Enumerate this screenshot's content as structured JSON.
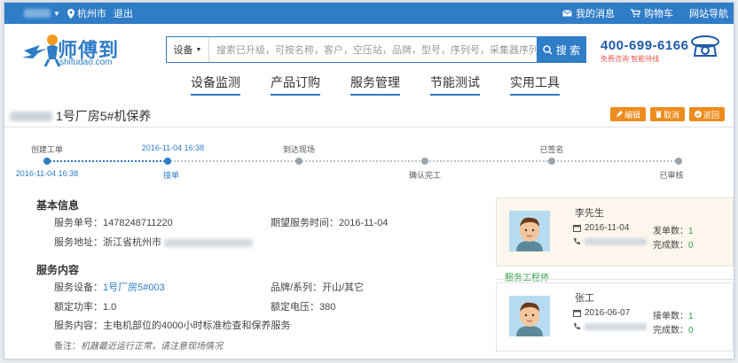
{
  "topbar": {
    "city": "杭州市",
    "logout": "退出",
    "messages": "我的消息",
    "cart": "购物车",
    "sitenav": "网站导航"
  },
  "logo": {
    "name": "师傅到",
    "domain": "shifudao.com"
  },
  "search": {
    "category": "设备",
    "placeholder": "搜索已升级，可按名称，客户，空压站，品牌，型号，序列号，采集器序列号搜索",
    "button": "搜 索"
  },
  "hotline": {
    "number": "400-699-6166",
    "subtitle": "免费咨询  智能待线"
  },
  "nav": [
    "设备监测",
    "产品订购",
    "服务管理",
    "节能测试",
    "实用工具"
  ],
  "page": {
    "title": "1号厂房5#机保养"
  },
  "actions": {
    "edit": "编辑",
    "cancel": "取消",
    "back": "返回"
  },
  "timeline": {
    "steps": [
      {
        "top": "创建工单",
        "bottom": "2016-11-04 16:38",
        "done": true
      },
      {
        "top": "2016-11-04 16:38",
        "bottom": "接单",
        "done": true
      },
      {
        "top": "到达现场",
        "bottom": "",
        "done": false
      },
      {
        "top": "",
        "bottom": "确认完工",
        "done": false
      },
      {
        "top": "已签名",
        "bottom": "",
        "done": false
      },
      {
        "top": "",
        "bottom": "已审核",
        "done": false
      }
    ]
  },
  "basic": {
    "title": "基本信息",
    "order_no_label": "服务单号：",
    "order_no": "1478248711220",
    "expect_label": "期望服务时间：",
    "expect": "2016-11-04",
    "addr_label": "服务地址：",
    "addr": "浙江省杭州市"
  },
  "content": {
    "title": "服务内容",
    "device_label": "服务设备：",
    "device": "1号厂房5#003",
    "brand_label": "品牌/系列：",
    "brand": "开山/其它",
    "power_label": "额定功率：",
    "power": "1.0",
    "voltage_label": "额定电压：",
    "voltage": "380",
    "desc_label": "服务内容：",
    "desc": "主电机部位的4000小时标准检查和保养服务",
    "note_label": "备注：",
    "note": "机器最近运行正常，请注意现场情况"
  },
  "customer": {
    "name": "李先生",
    "date": "2016-11-04",
    "stat1_label": "发单数：",
    "stat1": "1",
    "stat2_label": "完成数：",
    "stat2": "0"
  },
  "engineer": {
    "section": "服务工程师",
    "name": "张工",
    "date": "2016-06-07",
    "stat1_label": "接单数：",
    "stat1": "1",
    "stat2_label": "完成数：",
    "stat2": "0"
  },
  "colors": {
    "primary": "#2f7cc7",
    "accent": "#ef8c1f",
    "green": "#2fa14a"
  }
}
